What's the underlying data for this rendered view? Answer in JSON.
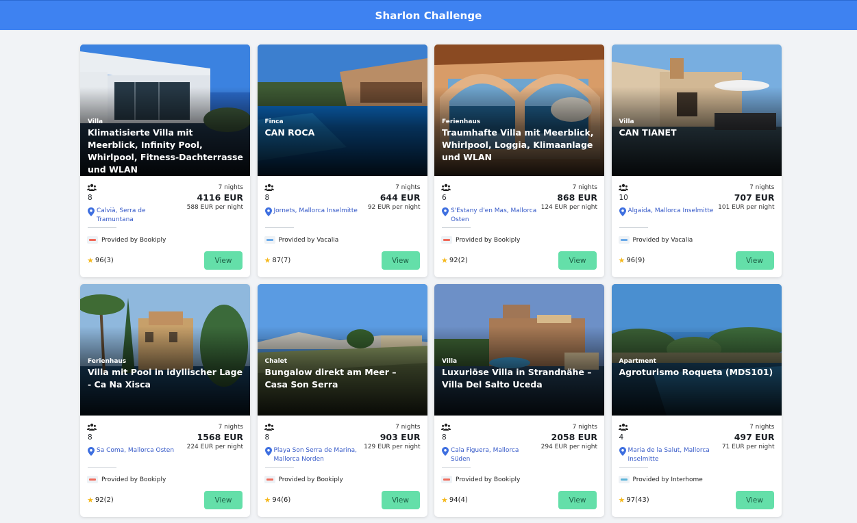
{
  "app": {
    "title": "Sharlon Challenge"
  },
  "colors": {
    "header": "#3e82f1",
    "view_button": "#64dfa9",
    "location": "#3559c8",
    "star": "#f5b81c"
  },
  "cards": [
    {
      "type": "Villa",
      "title": "Klimatisierte Villa mit Meerblick, Infinity Pool, Whirlpool, Fitness-Dachterrasse und WLAN",
      "guests": "8",
      "location": "Calvià, Serra de Tramuntana",
      "nights": "7 nights",
      "total": "4116 EUR",
      "per_night": "588 EUR per night",
      "provider": "Provided by Bookiply",
      "provider_color": "#f06a5a",
      "rating": "96(3)",
      "view_label": "View",
      "scene": "villa"
    },
    {
      "type": "Finca",
      "title": "CAN ROCA",
      "guests": "8",
      "location": "Jornets, Mallorca Inselmitte",
      "nights": "7 nights",
      "total": "644 EUR",
      "per_night": "92 EUR per night",
      "provider": "Provided by Vacalia",
      "provider_color": "#6aa9e8",
      "rating": "87(7)",
      "view_label": "View",
      "scene": "pool"
    },
    {
      "type": "Ferienhaus",
      "title": "Traumhafte Villa mit Meerblick, Whirlpool, Loggia, Klimaanlage und WLAN",
      "guests": "6",
      "location": "S'Estany d'en Mas, Mallorca Osten",
      "nights": "7 nights",
      "total": "868 EUR",
      "per_night": "124 EUR per night",
      "provider": "Provided by Bookiply",
      "provider_color": "#f06a5a",
      "rating": "92(2)",
      "view_label": "View",
      "scene": "arch"
    },
    {
      "type": "Villa",
      "title": "CAN TIANET",
      "guests": "10",
      "location": "Algaida, Mallorca Inselmitte",
      "nights": "7 nights",
      "total": "707 EUR",
      "per_night": "101 EUR per night",
      "provider": "Provided by Vacalia",
      "provider_color": "#6aa9e8",
      "rating": "96(9)",
      "view_label": "View",
      "scene": "house"
    },
    {
      "type": "Ferienhaus",
      "title": "Villa mit Pool in idyllischer Lage - Ca Na Xisca",
      "guests": "8",
      "location": "Sa Coma, Mallorca Osten",
      "nights": "7 nights",
      "total": "1568 EUR",
      "per_night": "224 EUR per night",
      "provider": "Provided by Bookiply",
      "provider_color": "#f06a5a",
      "rating": "92(2)",
      "view_label": "View",
      "scene": "palm"
    },
    {
      "type": "Chalet",
      "title": "Bungalow direkt am Meer – Casa Son Serra",
      "guests": "8",
      "location": "Playa Son Serra de Marina, Mallorca Norden",
      "nights": "7 nights",
      "total": "903 EUR",
      "per_night": "129 EUR per night",
      "provider": "Provided by Bookiply",
      "provider_color": "#f06a5a",
      "rating": "94(6)",
      "view_label": "View",
      "scene": "dune"
    },
    {
      "type": "Villa",
      "title": "Luxuriöse Villa in Strandnähe – Villa Del Salto Uceda",
      "guests": "8",
      "location": "Cala Figuera, Mallorca Süden",
      "nights": "7 nights",
      "total": "2058 EUR",
      "per_night": "294 EUR per night",
      "provider": "Provided by Bookiply",
      "provider_color": "#f06a5a",
      "rating": "94(4)",
      "view_label": "View",
      "scene": "stone"
    },
    {
      "type": "Apartment",
      "title": "Agroturismo Roqueta (MDS101)",
      "guests": "4",
      "location": "Maria de la Salut, Mallorca Inselmitte",
      "nights": "7 nights",
      "total": "497 EUR",
      "per_night": "71 EUR per night",
      "provider": "Provided by Interhome",
      "provider_color": "#5ab3d8",
      "rating": "97(43)",
      "view_label": "View",
      "scene": "garden"
    }
  ]
}
